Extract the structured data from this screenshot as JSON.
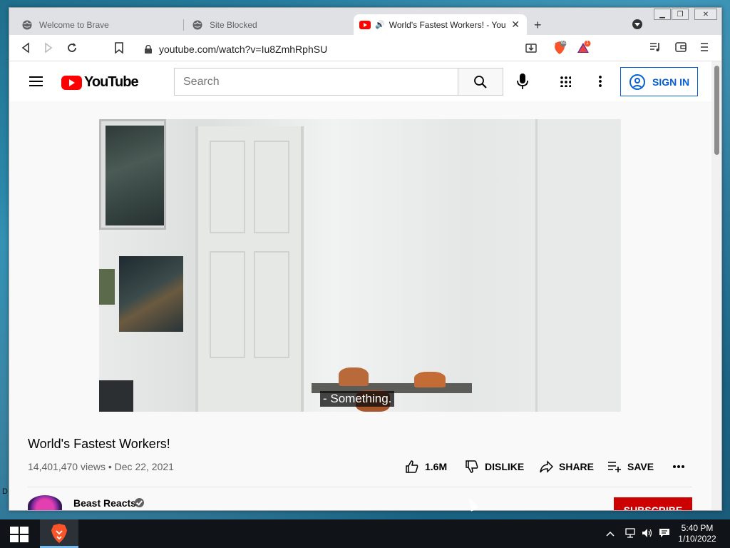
{
  "browser": {
    "tabs": [
      {
        "label": "Welcome to Brave",
        "active": false
      },
      {
        "label": "Site Blocked",
        "active": false
      },
      {
        "label": "World's Fastest Workers! - You",
        "active": true
      }
    ],
    "url": "youtube.com/watch?v=Iu8ZmhRphSU",
    "brave_shields_count": "60",
    "rewards_badge": "1"
  },
  "youtube": {
    "logo_text": "YouTube",
    "search_placeholder": "Search",
    "sign_in_label": "SIGN IN",
    "video": {
      "caption": "- Something.",
      "title": "World's Fastest Workers!",
      "views": "14,401,470 views",
      "date": "Dec 22, 2021",
      "like_count": "1.6M",
      "dislike_label": "DISLIKE",
      "share_label": "SHARE",
      "save_label": "SAVE"
    },
    "channel": {
      "name": "Beast Reacts",
      "subscribe_label": "SUBSCRIBE"
    }
  },
  "desktop": {
    "edge_text": "D"
  },
  "taskbar": {
    "time": "5:40 PM",
    "date": "1/10/2022"
  },
  "colors": {
    "youtube_red": "#ff0000",
    "signin_blue": "#065fd4",
    "subscribe_red": "#cc0000",
    "taskbar": "#101418"
  }
}
